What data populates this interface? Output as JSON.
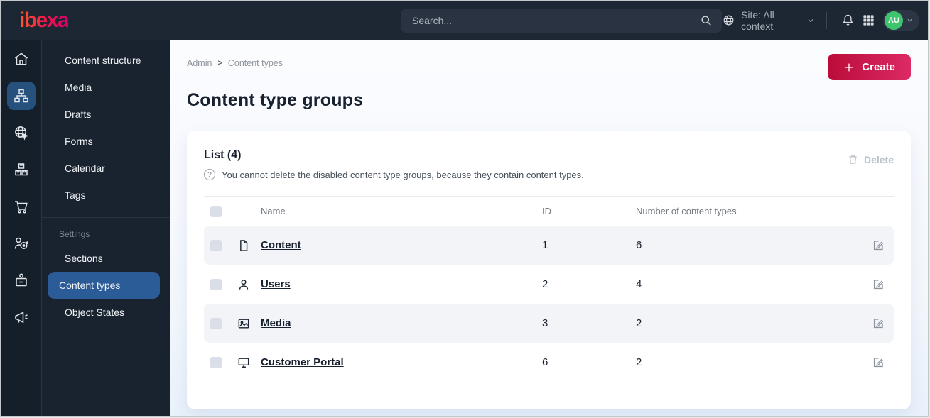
{
  "topbar": {
    "logo": "ibexa",
    "search_placeholder": "Search...",
    "site_selector": "Site: All context",
    "avatar_initials": "AU"
  },
  "sidebar": {
    "main": [
      "Content structure",
      "Media",
      "Drafts",
      "Forms",
      "Calendar",
      "Tags"
    ],
    "section_label": "Settings",
    "settings": [
      "Sections",
      "Content types",
      "Object States"
    ],
    "selected_item": "Content types"
  },
  "breadcrumb": {
    "items": [
      "Admin",
      "Content types"
    ],
    "separator": ">"
  },
  "page": {
    "title": "Content type groups",
    "create_label": "Create"
  },
  "list_card": {
    "title": "List (4)",
    "help_text": "You cannot delete the disabled content type groups, because they contain content types.",
    "delete_label": "Delete"
  },
  "table": {
    "columns": [
      "Name",
      "ID",
      "Number of content types"
    ],
    "rows": [
      {
        "icon": "file-icon",
        "name": "Content",
        "id": "1",
        "count": "6"
      },
      {
        "icon": "user-icon",
        "name": "Users",
        "id": "2",
        "count": "4"
      },
      {
        "icon": "image-icon",
        "name": "Media",
        "id": "3",
        "count": "2"
      },
      {
        "icon": "monitor-icon",
        "name": "Customer Portal",
        "id": "6",
        "count": "2"
      }
    ]
  },
  "icons": {
    "rail": [
      "home-icon",
      "content-tree-icon",
      "site-globe-icon",
      "product-catalog-icon",
      "commerce-cart-icon",
      "personalization-target-icon",
      "admin-badge-icon",
      "campaign-megaphone-icon"
    ]
  },
  "colors": {
    "topbar_bg": "#1d2733",
    "sidebar_bg": "#19232f",
    "selected_blue": "#2b5c97",
    "create_gradient_start": "#bb0c39",
    "create_gradient_end": "#dc2a64",
    "avatar_green": "#3ec46f",
    "text_dark": "#17202e",
    "row_stripe": "#f3f4f7"
  }
}
